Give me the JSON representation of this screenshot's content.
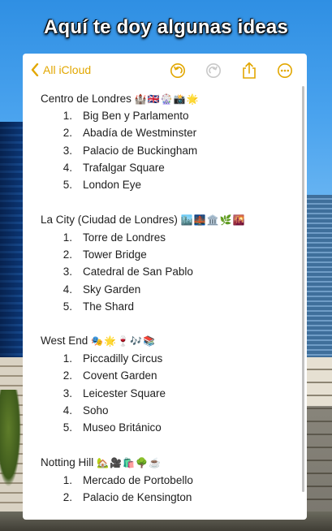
{
  "caption": "Aquí te doy algunas ideas",
  "toolbar": {
    "back_label": "All iCloud",
    "icons": [
      "chevron-left-icon",
      "undo-icon",
      "redo-icon",
      "share-icon",
      "more-icon"
    ],
    "accent_color": "#e2a700"
  },
  "sections": [
    {
      "title": "Centro de Londres",
      "emojis": "🏰🇬🇧🎡📸🌟",
      "items": [
        "Big Ben y Parlamento",
        "Abadía de Westminster",
        "Palacio de Buckingham",
        "Trafalgar Square",
        "London Eye"
      ]
    },
    {
      "title": "La City (Ciudad de Londres)",
      "emojis": "🏙️🌉🏛️🌿🌇",
      "items": [
        "Torre de Londres",
        "Tower Bridge",
        "Catedral de San Pablo",
        "Sky Garden",
        "The Shard"
      ]
    },
    {
      "title": "West End",
      "emojis": "🎭🌟🍷🎶📚",
      "items": [
        "Piccadilly Circus",
        "Covent Garden",
        "Leicester Square",
        "Soho",
        "Museo Británico"
      ]
    },
    {
      "title": "Notting Hill",
      "emojis": "🏡🎥🛍️🌳☕",
      "items": [
        "Mercado de Portobello",
        "Palacio de Kensington"
      ]
    }
  ]
}
